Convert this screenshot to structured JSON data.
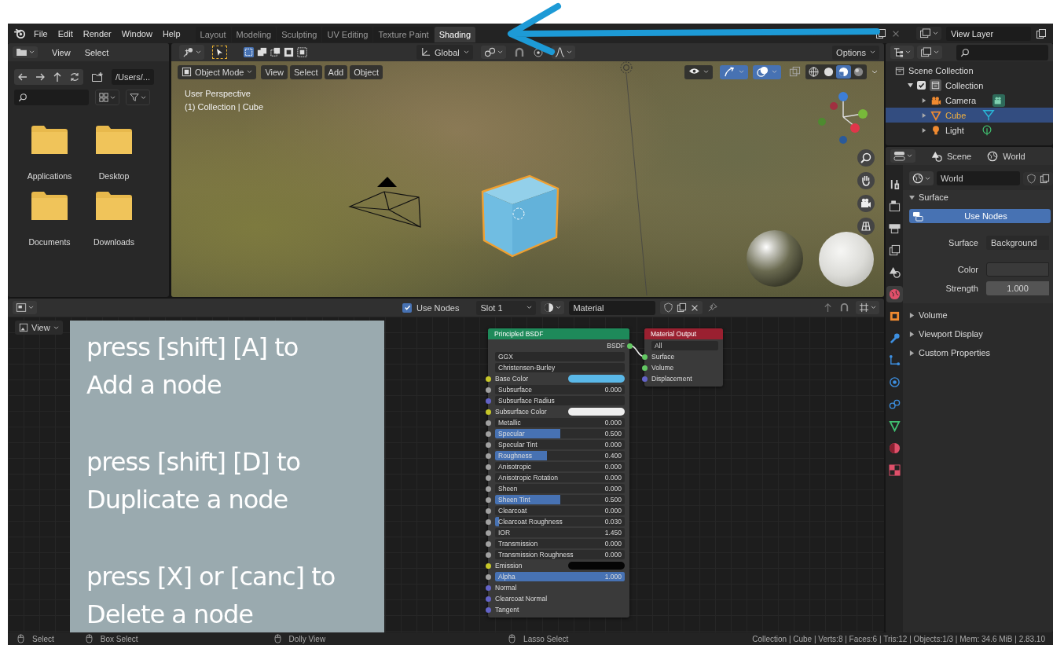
{
  "menu": [
    "File",
    "Edit",
    "Render",
    "Window",
    "Help"
  ],
  "workspace_tabs": [
    {
      "label": "Layout",
      "selected": false
    },
    {
      "label": "Modeling",
      "selected": false
    },
    {
      "label": "Sculpting",
      "selected": false
    },
    {
      "label": "UV Editing",
      "selected": false
    },
    {
      "label": "Texture Paint",
      "selected": false
    },
    {
      "label": "Shading",
      "selected": true
    }
  ],
  "view_layer": "View Layer",
  "file_browser": {
    "menu": [
      "View",
      "Select"
    ],
    "path": "/Users/...",
    "folders": [
      {
        "name": "Applications"
      },
      {
        "name": "Desktop"
      },
      {
        "name": "Documents"
      },
      {
        "name": "Downloads"
      }
    ]
  },
  "viewport": {
    "orientation": "Global",
    "options": "Options",
    "mode": "Object Mode",
    "menu": [
      "View",
      "Select",
      "Add",
      "Object"
    ],
    "info": [
      "User Perspective",
      "(1) Collection | Cube"
    ],
    "gizmos_on": true,
    "overlays_on": true,
    "shading_modes": [
      {
        "kind": "wireframe",
        "selected": false
      },
      {
        "kind": "solid",
        "selected": false
      },
      {
        "kind": "material",
        "selected": true
      },
      {
        "kind": "rendered",
        "selected": false
      }
    ]
  },
  "node_editor": {
    "view": "View",
    "use_nodes": {
      "label": "Use Nodes",
      "checked": true
    },
    "slot": "Slot 1",
    "material": "Material",
    "nodes": [
      {
        "kind": "bsdf",
        "title": "Principled BSDF",
        "output": "BSDF",
        "options": [
          "GGX",
          "Christensen-Burley"
        ],
        "inputs": [
          {
            "kind": "color",
            "label": "Base Color",
            "color": "#5ab8e8"
          },
          {
            "kind": "slider",
            "label": "Subsurface",
            "value": "0.000",
            "level": 0
          },
          {
            "kind": "dropdown",
            "label": "Subsurface Radius"
          },
          {
            "kind": "color",
            "label": "Subsurface Color",
            "color": "#eeeeee"
          },
          {
            "kind": "slider",
            "label": "Metallic",
            "value": "0.000",
            "level": 0
          },
          {
            "kind": "slider",
            "label": "Specular",
            "value": "0.500",
            "level": 0.5
          },
          {
            "kind": "slider",
            "label": "Specular Tint",
            "value": "0.000",
            "level": 0
          },
          {
            "kind": "slider",
            "label": "Roughness",
            "value": "0.400",
            "level": 0.4
          },
          {
            "kind": "slider",
            "label": "Anisotropic",
            "value": "0.000",
            "level": 0
          },
          {
            "kind": "slider",
            "label": "Anisotropic Rotation",
            "value": "0.000",
            "level": 0
          },
          {
            "kind": "slider",
            "label": "Sheen",
            "value": "0.000",
            "level": 0
          },
          {
            "kind": "slider",
            "label": "Sheen Tint",
            "value": "0.500",
            "level": 0.5
          },
          {
            "kind": "slider",
            "label": "Clearcoat",
            "value": "0.000",
            "level": 0
          },
          {
            "kind": "slider",
            "label": "Clearcoat Roughness",
            "value": "0.030",
            "level": 0.03
          },
          {
            "kind": "number",
            "label": "IOR",
            "value": "1.450"
          },
          {
            "kind": "slider",
            "label": "Transmission",
            "value": "0.000",
            "level": 0
          },
          {
            "kind": "slider",
            "label": "Transmission Roughness",
            "value": "0.000",
            "level": 0
          },
          {
            "kind": "color",
            "label": "Emission",
            "color": "#050505"
          },
          {
            "kind": "slider",
            "label": "Alpha",
            "value": "1.000",
            "level": 1
          },
          {
            "kind": "vector",
            "label": "Normal"
          },
          {
            "kind": "vector",
            "label": "Clearcoat Normal"
          },
          {
            "kind": "vector",
            "label": "Tangent"
          }
        ]
      },
      {
        "kind": "output",
        "title": "Material Output",
        "options": [
          "All"
        ],
        "inputs": [
          {
            "kind": "shader",
            "label": "Surface"
          },
          {
            "kind": "shader",
            "label": "Volume"
          },
          {
            "kind": "vector",
            "label": "Displacement"
          }
        ]
      }
    ]
  },
  "hint_box": [
    "press [shift] [A] to\nAdd a node",
    "press [shift] [D] to\nDuplicate a node",
    "press [X] or [canc] to\nDelete a node"
  ],
  "outliner": {
    "tree": [
      {
        "name": "Scene Collection",
        "kind": "scene_collection",
        "children": [
          {
            "name": "Collection",
            "kind": "collection",
            "checked": true,
            "expanded": true,
            "children": [
              {
                "name": "Camera",
                "kind": "camera",
                "selected": false
              },
              {
                "name": "Cube",
                "kind": "mesh",
                "selected": true
              },
              {
                "name": "Light",
                "kind": "light",
                "selected": false
              }
            ]
          }
        ]
      }
    ]
  },
  "properties": {
    "tabs": [
      "Scene",
      "World"
    ],
    "world": "World",
    "side_tabs": [
      {
        "kind": "tool",
        "selected": false
      },
      {
        "kind": "render",
        "selected": false
      },
      {
        "kind": "output",
        "selected": false
      },
      {
        "kind": "view_layer",
        "selected": false
      },
      {
        "kind": "scene",
        "selected": false
      },
      {
        "kind": "world",
        "selected": true
      },
      {
        "kind": "object",
        "selected": false
      },
      {
        "kind": "modifiers",
        "selected": false
      },
      {
        "kind": "particles",
        "selected": false
      },
      {
        "kind": "physics",
        "selected": false
      },
      {
        "kind": "constraints",
        "selected": false
      },
      {
        "kind": "data",
        "selected": false
      },
      {
        "kind": "material",
        "selected": false
      },
      {
        "kind": "texture",
        "selected": false
      }
    ],
    "panels": [
      {
        "title": "Surface",
        "expanded": true,
        "button": "Use Nodes",
        "fields": [
          {
            "kind": "dropdown",
            "label": "Surface",
            "value": "Background"
          },
          {
            "kind": "color",
            "label": "Color",
            "color": "#3a3a3a"
          },
          {
            "kind": "number",
            "label": "Strength",
            "value": "1.000"
          }
        ]
      },
      {
        "title": "Volume",
        "expanded": false
      },
      {
        "title": "Viewport Display",
        "expanded": false
      },
      {
        "title": "Custom Properties",
        "expanded": false
      }
    ]
  },
  "status_bar": {
    "hints": [
      "Select",
      "Box Select",
      "Dolly View",
      "Lasso Select"
    ],
    "stats": "Collection | Cube | Verts:8 | Faces:6 | Tris:12 | Objects:1/3 | Mem: 34.6 MiB | 2.83.10"
  }
}
